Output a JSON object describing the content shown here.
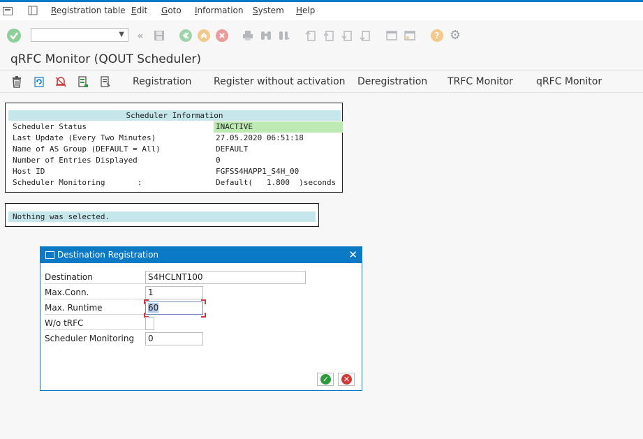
{
  "menu": {
    "items": [
      "Registration table",
      "Edit",
      "Goto",
      "Information",
      "System",
      "Help"
    ]
  },
  "toolbar": {
    "command_field_value": ""
  },
  "page": {
    "title": "qRFC Monitor (QOUT Scheduler)"
  },
  "app_toolbar": {
    "buttons": [
      "Registration",
      "Register without activation",
      "Deregistration",
      "TRFC Monitor",
      "qRFC Monitor"
    ]
  },
  "scheduler_info": {
    "header": "Scheduler Information",
    "rows": [
      {
        "label": "Scheduler Status",
        "value": "INACTIVE"
      },
      {
        "label": "Last Update (Every Two Minutes)",
        "value": "27.05.2020 06:51:18"
      },
      {
        "label": "Name of AS Group (DEFAULT = All)",
        "value": "DEFAULT"
      },
      {
        "label": "Number of Entries Displayed",
        "value": "0"
      },
      {
        "label": "Host ID",
        "value": "FGFSS4HAPP1_S4H_00"
      },
      {
        "label": "Scheduler Monitoring       :",
        "value": "Default(   1.800  )seconds"
      }
    ]
  },
  "message": "Nothing was selected.",
  "dialog": {
    "title": "Destination Registration",
    "fields": [
      {
        "label": "Destination",
        "value": "S4HCLNT100"
      },
      {
        "label": "Max.Conn.",
        "value": "1"
      },
      {
        "label": "Max. Runtime",
        "value": "60"
      },
      {
        "label": "W/o tRFC",
        "value": ""
      },
      {
        "label": "Scheduler Monitoring",
        "value": "0"
      }
    ]
  },
  "colors": {
    "accent": "#0a7ac6",
    "status_inactive_bg": "#bdeab2",
    "info_header_bg": "#c5e6ea",
    "confirm": "#2c9b3c",
    "cancel": "#d13a3a"
  }
}
